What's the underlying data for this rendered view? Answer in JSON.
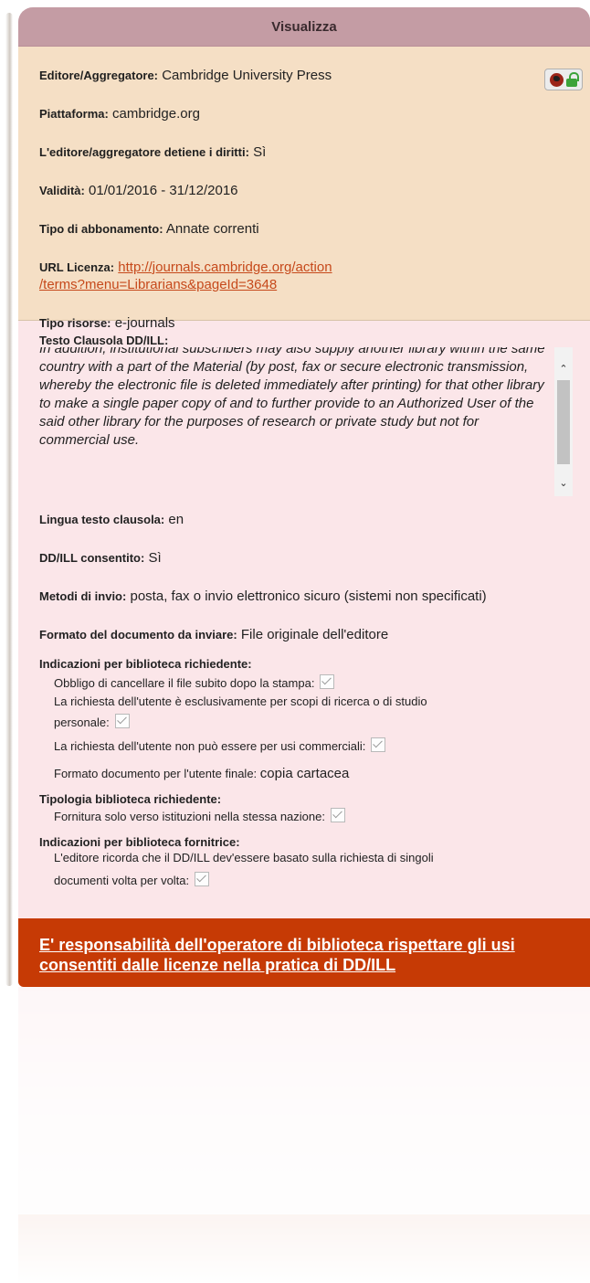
{
  "panel": {
    "title": "Visualizza"
  },
  "info": {
    "publisher_label": "Editore/Aggregatore:",
    "publisher_value": "Cambridge University Press",
    "platform_label": "Piattaforma:",
    "platform_value": "cambridge.org",
    "rights_label": "L'editore/aggregatore detiene i diritti:",
    "rights_value": "Sì",
    "validity_label": "Validità:",
    "validity_value": "01/01/2016 - 31/12/2016",
    "subscription_label": "Tipo di abbonamento:",
    "subscription_value": "Annate correnti",
    "license_url_label": "URL Licenza:",
    "license_url_line1": "http://journals.cambridge.org/action",
    "license_url_line2": "/terms?menu=Librarians&pageId=3648",
    "resources_label": "Tipo risorse:",
    "resources_value": "e-journals"
  },
  "clause": {
    "label": "Testo Clausola DD/ILL:",
    "text": "In addition, institutional subscribers may also supply another library within the same country with a part of the Material (by post, fax or secure electronic transmission, whereby the electronic file is deleted immediately after printing) for that other library to make a single paper copy of and to further provide to an Authorized User of the said other library for the purposes of research or private study but not for commercial use.",
    "language_label": "Lingua testo clausola:",
    "language_value": "en",
    "allowed_label": "DD/ILL consentito:",
    "allowed_value": "Sì",
    "methods_label": "Metodi di invio:",
    "methods_value": "posta, fax o invio elettronico sicuro (sistemi non specificati)",
    "format_label": "Formato del documento da inviare:",
    "format_value": "File originale dell'editore"
  },
  "requesting": {
    "heading": "Indicazioni per biblioteca richiedente:",
    "item1": "Obbligo di cancellare il file subito dopo la stampa:",
    "item2_line1": "La richiesta dell'utente è esclusivamente per scopi di ricerca o di studio",
    "item2_line2": "personale:",
    "item3": "La richiesta dell'utente non può essere per usi commerciali:",
    "item4_label": "Formato documento per l'utente finale:",
    "item4_value": "copia cartacea"
  },
  "library_type": {
    "heading": "Tipologia biblioteca richiedente:",
    "item1": "Fornitura solo verso istituzioni nella stessa nazione:"
  },
  "supplying": {
    "heading": "Indicazioni per biblioteca fornitrice:",
    "item1_line1": "L'editore ricorda che il DD/ILL dev'essere basato sulla richiesta di singoli",
    "item1_line2": "documenti volta per volta:"
  },
  "footer": {
    "link_line1": "E' responsabilità dell'operatore di biblioteca rispettare gli usi",
    "link_line2": "consentiti dalle licenze nella pratica di DD/ILL"
  },
  "icons": {
    "open_access": "globe-icon",
    "unlocked": "unlocked-padlock-icon"
  },
  "colors": {
    "header_bg": "#c49ca4",
    "top_bg": "#f5dfc5",
    "bottom_bg": "#fbe6e9",
    "footer_bg": "#c63a05",
    "link": "#c6491b"
  }
}
